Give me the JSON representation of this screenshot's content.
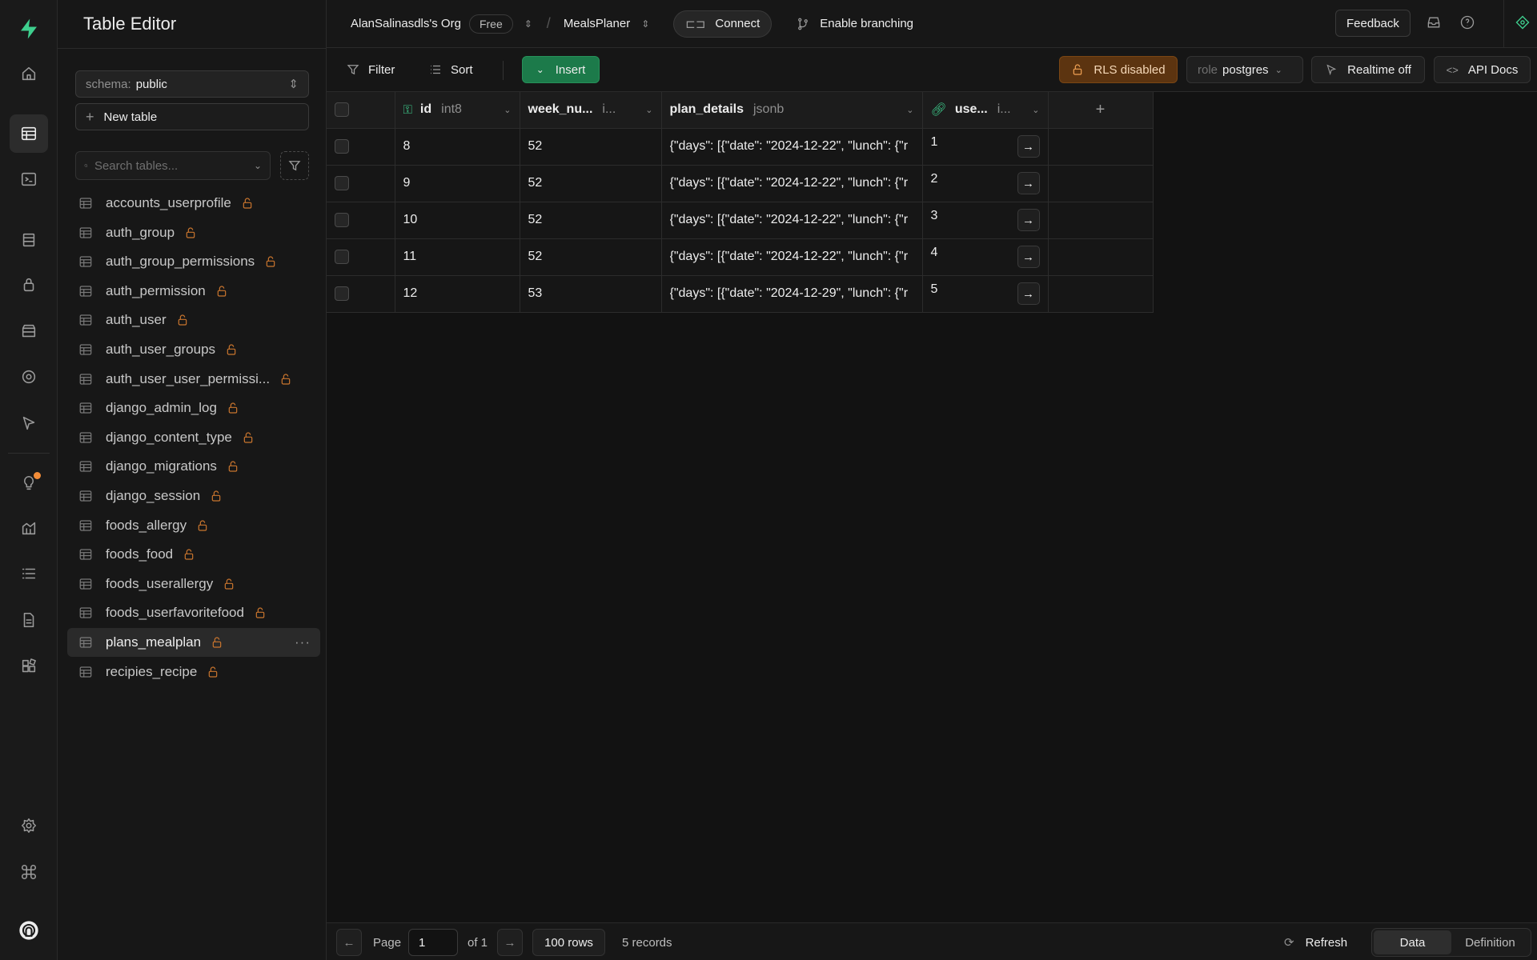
{
  "app": {
    "title": "Table Editor"
  },
  "topbar": {
    "org": "AlanSalinasdls's Org",
    "plan": "Free",
    "project": "MealsPlaner",
    "connect": "Connect",
    "branching": "Enable branching",
    "feedback": "Feedback"
  },
  "sidebar": {
    "schema_key": "schema:",
    "schema_value": "public",
    "new_table": "New table",
    "search_placeholder": "Search tables...",
    "tables": [
      {
        "name": "accounts_userprofile"
      },
      {
        "name": "auth_group"
      },
      {
        "name": "auth_group_permissions"
      },
      {
        "name": "auth_permission"
      },
      {
        "name": "auth_user"
      },
      {
        "name": "auth_user_groups"
      },
      {
        "name": "auth_user_user_permissi..."
      },
      {
        "name": "django_admin_log"
      },
      {
        "name": "django_content_type"
      },
      {
        "name": "django_migrations"
      },
      {
        "name": "django_session"
      },
      {
        "name": "foods_allergy"
      },
      {
        "name": "foods_food"
      },
      {
        "name": "foods_userallergy"
      },
      {
        "name": "foods_userfavoritefood"
      },
      {
        "name": "plans_mealplan"
      },
      {
        "name": "recipies_recipe"
      }
    ],
    "active_table": "plans_mealplan"
  },
  "toolbar": {
    "filter": "Filter",
    "sort": "Sort",
    "insert": "Insert",
    "rls": "RLS disabled",
    "role_key": "role",
    "role_value": "postgres",
    "realtime": "Realtime off",
    "api_docs": "API Docs"
  },
  "grid": {
    "columns": [
      {
        "name": "id",
        "type": "int8"
      },
      {
        "name": "week_nu...",
        "type": "i..."
      },
      {
        "name": "plan_details",
        "type": "jsonb"
      },
      {
        "name": "use...",
        "type": "i..."
      }
    ],
    "rows": [
      {
        "id": "8",
        "week": "52",
        "plan": "{\"days\": [{\"date\": \"2024-12-22\", \"lunch\": {\"r",
        "user": "1"
      },
      {
        "id": "9",
        "week": "52",
        "plan": "{\"days\": [{\"date\": \"2024-12-22\", \"lunch\": {\"r",
        "user": "2"
      },
      {
        "id": "10",
        "week": "52",
        "plan": "{\"days\": [{\"date\": \"2024-12-22\", \"lunch\": {\"r",
        "user": "3"
      },
      {
        "id": "11",
        "week": "52",
        "plan": "{\"days\": [{\"date\": \"2024-12-22\", \"lunch\": {\"r",
        "user": "4"
      },
      {
        "id": "12",
        "week": "53",
        "plan": "{\"days\": [{\"date\": \"2024-12-29\", \"lunch\": {\"r",
        "user": "5"
      }
    ]
  },
  "footer": {
    "page_label": "Page",
    "page_value": "1",
    "of_label": "of 1",
    "rows_per_page": "100 rows",
    "records": "5 records",
    "refresh": "Refresh",
    "tab_data": "Data",
    "tab_definition": "Definition"
  },
  "colors": {
    "accent": "#3ecf8e",
    "insert_bg": "#1c7a4a",
    "rls_bg": "#5c3410",
    "lock": "#c9752e",
    "notification_dot": "#f28c38"
  }
}
